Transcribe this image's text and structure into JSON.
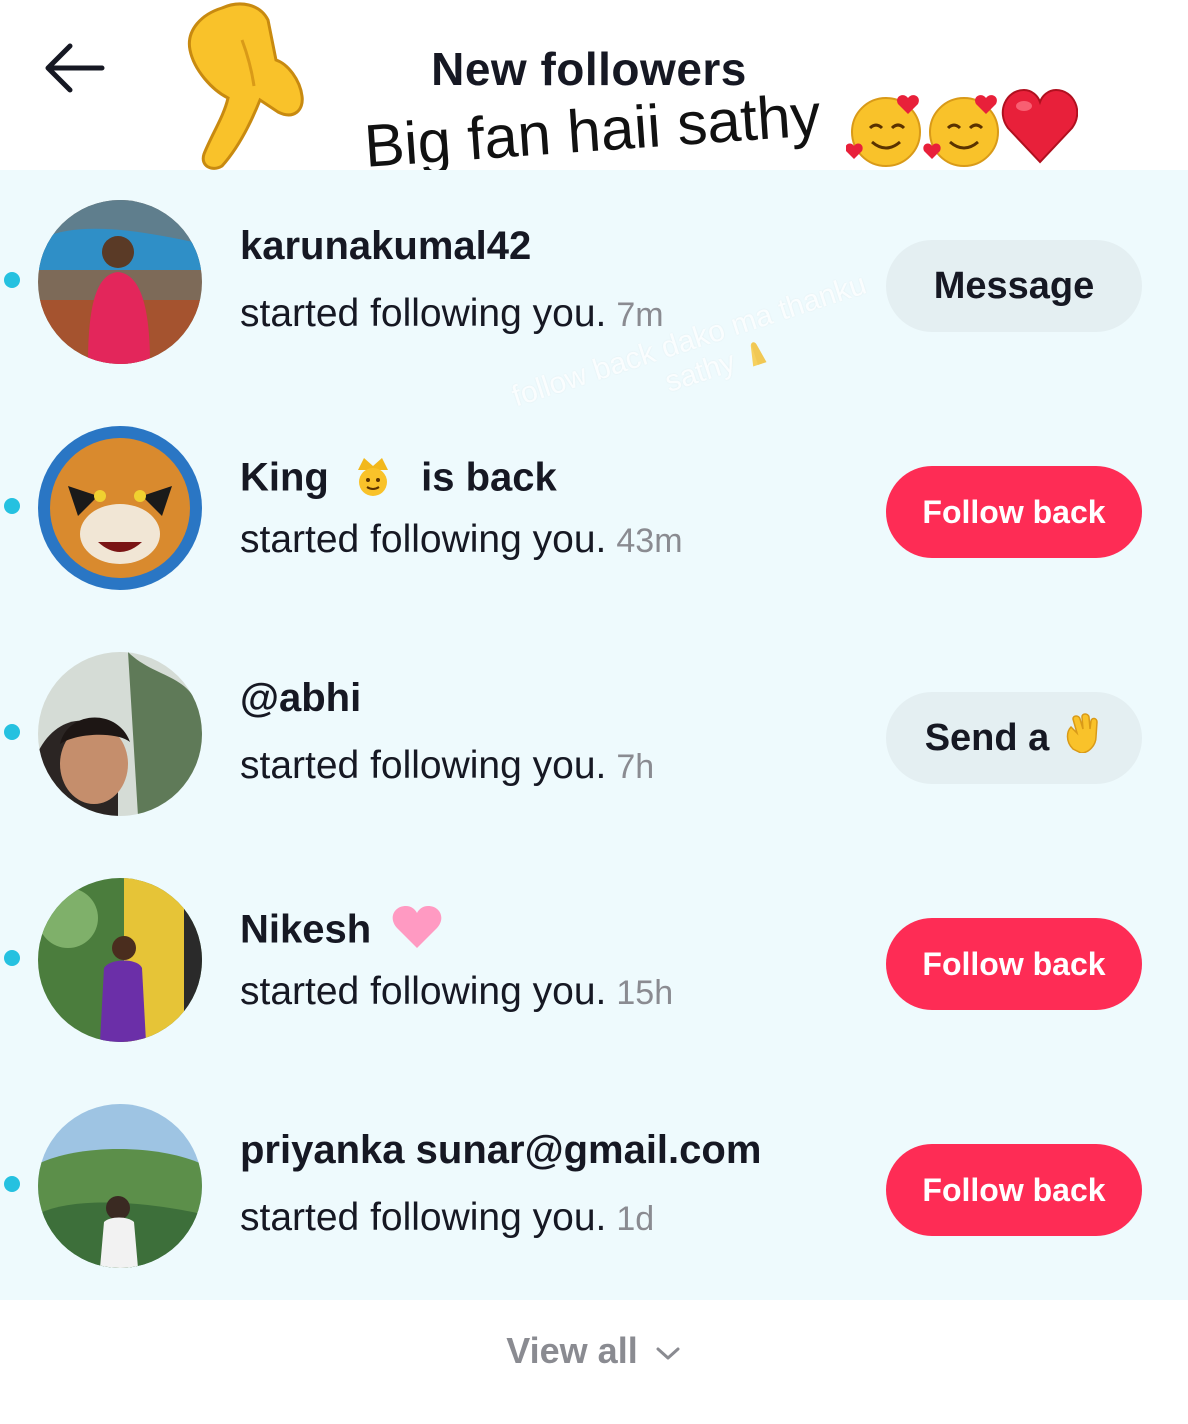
{
  "header": {
    "title": "New followers",
    "back_icon": "arrow-left-icon"
  },
  "caption": {
    "text": "Big fan haii sathy",
    "emojis": [
      "smiling-face-with-hearts",
      "smiling-face-with-hearts",
      "red-heart"
    ]
  },
  "overlay": {
    "line1": "follow back dako ma thanku",
    "line2": "sathy"
  },
  "followers": [
    {
      "name": "karunakumal42",
      "activity": "started following you.",
      "time": "7m",
      "action": "Message",
      "action_style": "gray"
    },
    {
      "name_part1": "King",
      "name_emoji": "crown-person-icon",
      "name_part2": "is back",
      "activity": "started following you.",
      "time": "43m",
      "action": "Follow back",
      "action_style": "red"
    },
    {
      "name": "@abhi",
      "activity": "started following you.",
      "time": "7h",
      "action": "Send a",
      "action_emoji": "waving-hand-icon",
      "action_style": "gray"
    },
    {
      "name": "Nikesh",
      "name_emoji": "pink-heart-icon",
      "activity": "started following you.",
      "time": "15h",
      "action": "Follow back",
      "action_style": "red"
    },
    {
      "name": "priyanka sunar@gmail.com",
      "activity": "started following you.",
      "time": "1d",
      "action": "Follow back",
      "action_style": "red"
    }
  ],
  "footer": {
    "view_all": "View all"
  },
  "colors": {
    "accent": "#fe2c55",
    "unread_dot": "#25c1e0",
    "list_bg": "#eefafd",
    "button_gray": "#e4eff2"
  }
}
